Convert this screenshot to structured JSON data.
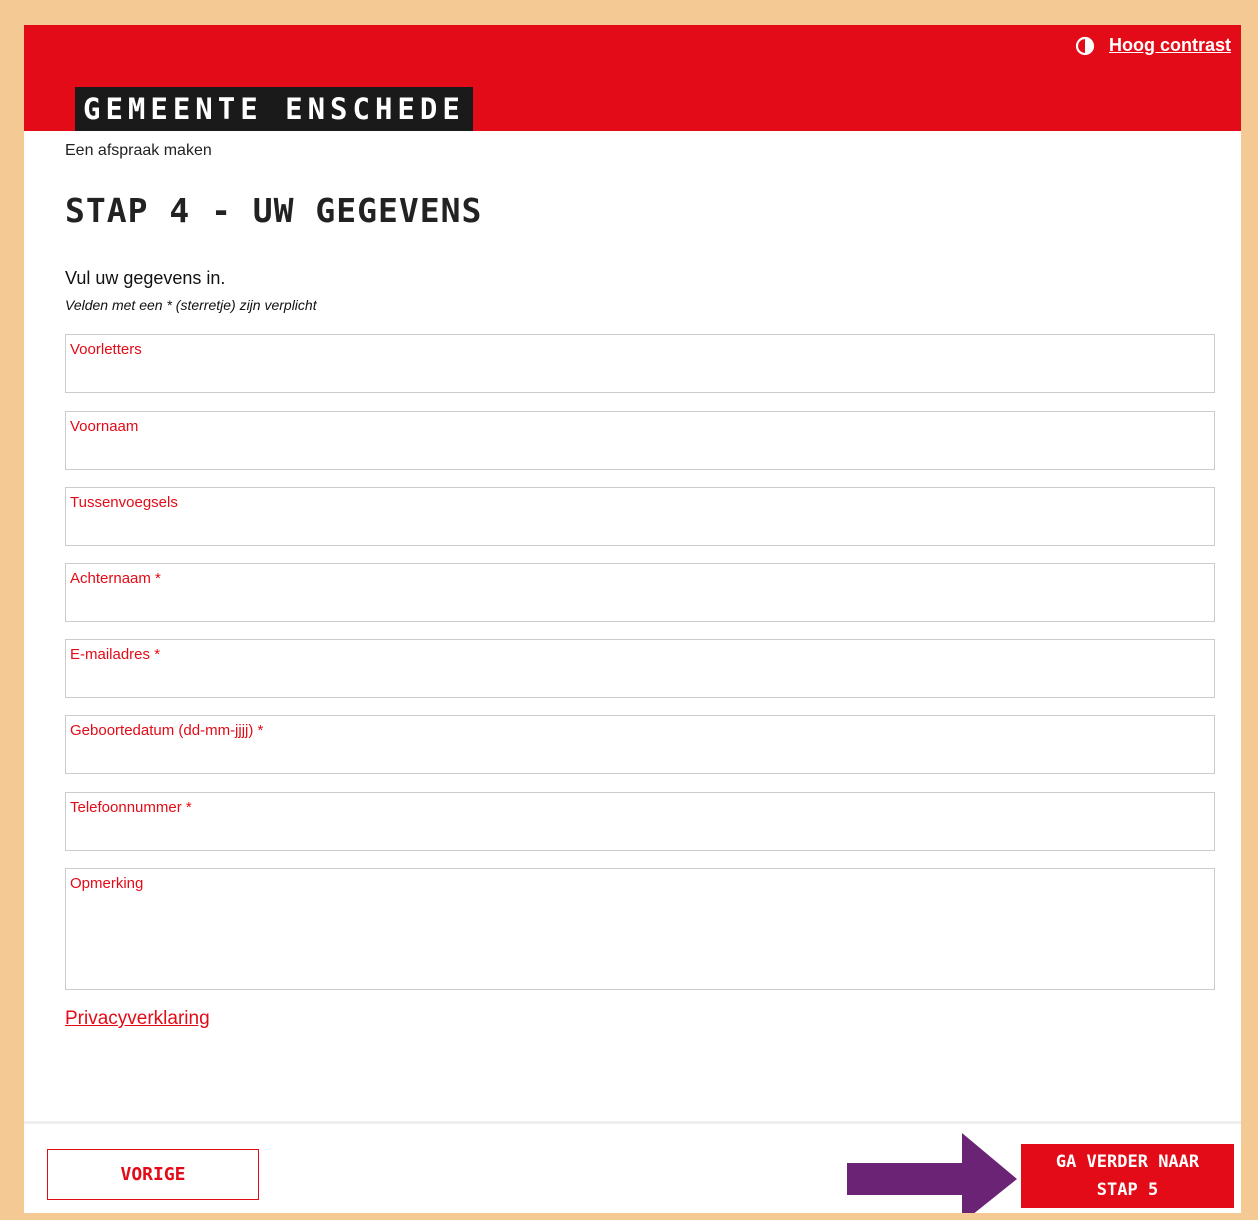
{
  "header": {
    "contrast_label": "Hoog contrast",
    "logo_text": "GEMEENTE ENSCHEDE",
    "brand_color": "#e30b17"
  },
  "breadcrumb": "Een afspraak maken",
  "page_title": "STAP 4 - UW GEGEVENS",
  "intro": "Vul uw gegevens in.",
  "required_note": "Velden met een * (sterretje) zijn verplicht",
  "form": {
    "fields": [
      {
        "label": "Voorletters",
        "value": ""
      },
      {
        "label": "Voornaam",
        "value": ""
      },
      {
        "label": "Tussenvoegsels",
        "value": ""
      },
      {
        "label": "Achternaam *",
        "value": ""
      },
      {
        "label": "E-mailadres *",
        "value": ""
      },
      {
        "label": "Geboortedatum (dd-mm-jjjj) *",
        "value": ""
      },
      {
        "label": "Telefoonnummer *",
        "value": ""
      },
      {
        "label": "Opmerking",
        "value": ""
      }
    ]
  },
  "privacy_link": "Privacyverklaring",
  "footer": {
    "prev_label": "VORIGE",
    "next_label": "GA VERDER NAAR STAP 5"
  },
  "annotation": {
    "arrow_color": "#6b2475",
    "icon": "right-arrow-icon"
  }
}
